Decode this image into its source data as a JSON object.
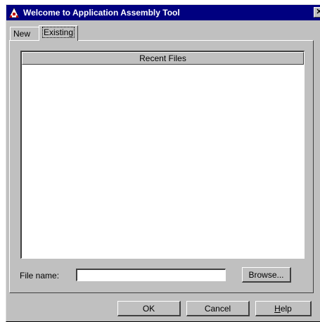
{
  "window": {
    "title": "Welcome to Application Assembly Tool",
    "close_glyph": "✕"
  },
  "tabs": [
    {
      "label": "New",
      "selected": false
    },
    {
      "label": "Existing",
      "selected": true
    }
  ],
  "recent_files": {
    "header": "Recent Files",
    "items": []
  },
  "file_name": {
    "label": "File name:",
    "value": ""
  },
  "buttons": {
    "browse": "Browse...",
    "ok": "OK",
    "cancel": "Cancel",
    "help_mnemonic": "H",
    "help_rest": "elp"
  },
  "colors": {
    "titlebar": "#000080",
    "face": "#c0c0c0"
  },
  "icons": {
    "app": "application-assembly-icon",
    "close": "close-icon"
  }
}
